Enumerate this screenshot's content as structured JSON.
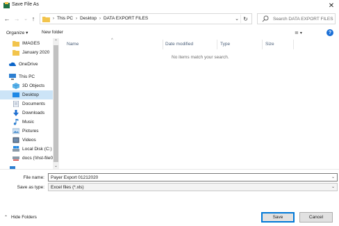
{
  "window": {
    "title": "Save File As",
    "close_glyph": "✕"
  },
  "nav": {
    "back_glyph": "←",
    "forward_glyph": "→",
    "recent_glyph": "⌄",
    "up_glyph": "↑",
    "breadcrumb": [
      "This PC",
      "Desktop",
      "DATA EXPORT FILES"
    ],
    "breadcrumb_sep": "›",
    "dropdown_glyph": "⌄",
    "refresh_glyph": "↻",
    "search_placeholder": "Search DATA EXPORT FILES"
  },
  "toolbar": {
    "organize_label": "Organize ▾",
    "new_folder_label": "New folder",
    "view_glyph": "≣",
    "view_chevron": "▾",
    "help_glyph": "?"
  },
  "sidebar": {
    "items": [
      {
        "label": "IMAGES",
        "icon": "folder-icon"
      },
      {
        "label": "January 2020",
        "icon": "folder-icon"
      },
      {
        "label": "OneDrive",
        "icon": "cloud-icon"
      },
      {
        "label": "This PC",
        "icon": "computer-icon"
      },
      {
        "label": "3D Objects",
        "icon": "cube-icon"
      },
      {
        "label": "Desktop",
        "icon": "desktop-icon",
        "selected": true
      },
      {
        "label": "Documents",
        "icon": "document-icon"
      },
      {
        "label": "Downloads",
        "icon": "download-icon"
      },
      {
        "label": "Music",
        "icon": "music-icon"
      },
      {
        "label": "Pictures",
        "icon": "picture-icon"
      },
      {
        "label": "Videos",
        "icon": "video-icon"
      },
      {
        "label": "Local Disk (C:)",
        "icon": "drive-icon"
      },
      {
        "label": "docs (\\\\hst-file0",
        "icon": "network-drive-icon"
      }
    ],
    "scroll_up_glyph": "⌃",
    "scroll_down_glyph": "⌄"
  },
  "content": {
    "columns": [
      "Name",
      "Date modified",
      "Type",
      "Size"
    ],
    "sort_glyph": "^",
    "empty_message": "No items match your search."
  },
  "form": {
    "file_name_label": "File name:",
    "file_name_value": "Payer Export 01212020",
    "save_type_label": "Save as type:",
    "save_type_value": "Excel files (*.xls)",
    "chevron": "⌄"
  },
  "footer": {
    "hide_folders_glyph": "⌃",
    "hide_folders_label": "Hide Folders",
    "save_label": "Save",
    "cancel_label": "Cancel"
  },
  "colors": {
    "accent": "#0078d7",
    "folder": "#f2c44c",
    "selected": "#cce4f7",
    "help": "#1a6fd6"
  }
}
